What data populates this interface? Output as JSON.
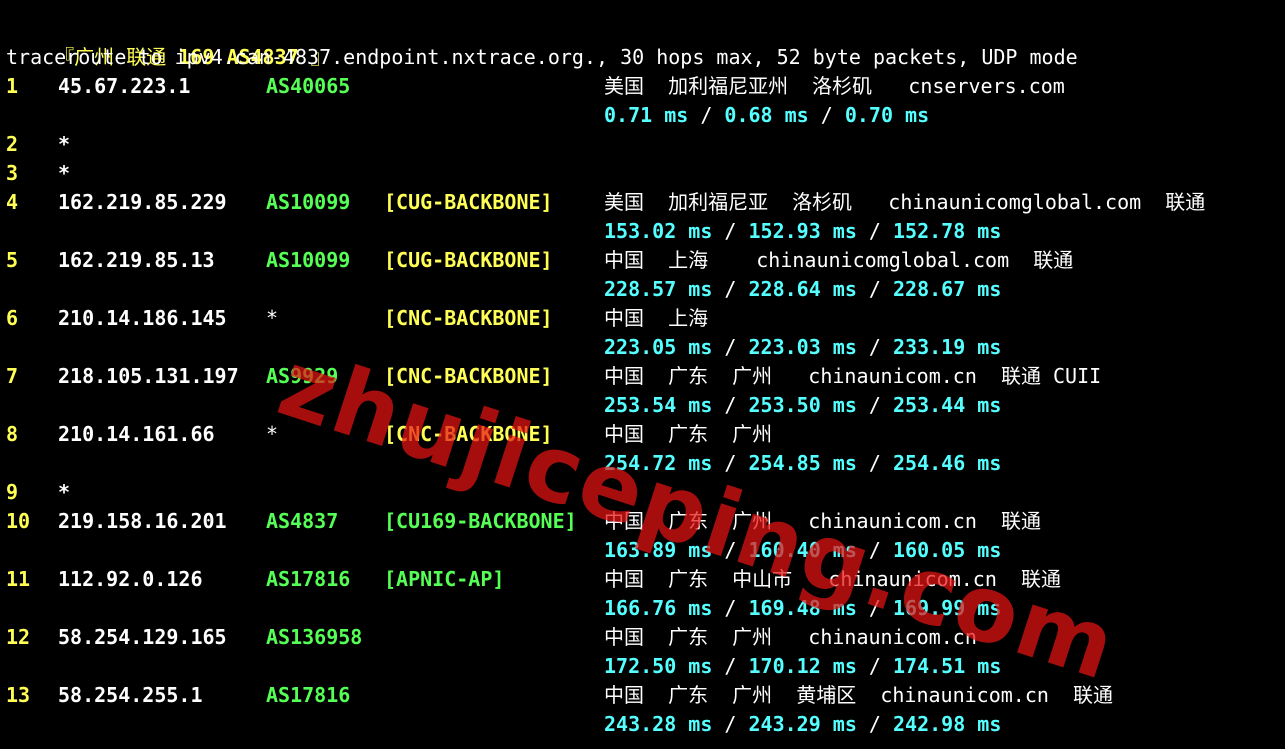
{
  "header": {
    "bracket_open": "『",
    "city": "广州",
    "isp": "联通",
    "route_no": "169",
    "asn": "AS4837",
    "bracket_close": "』"
  },
  "command_line": "traceroute to ipv4.can-4837.endpoint.nxtrace.org., 30 hops max, 52 byte packets, UDP mode",
  "hops": [
    {
      "hop": "1",
      "ip": "45.67.223.1",
      "asn": "AS40065",
      "tag": "",
      "geo": "美国  加利福尼亚州  洛杉矶   cnservers.com",
      "rtt": [
        "0.71 ms",
        "0.68 ms",
        "0.70 ms"
      ]
    },
    {
      "hop": "2",
      "ip": "*"
    },
    {
      "hop": "3",
      "ip": "*"
    },
    {
      "hop": "4",
      "ip": "162.219.85.229",
      "asn": "AS10099",
      "tag": "[CUG-BACKBONE]",
      "geo": "美国  加利福尼亚  洛杉矶   chinaunicomglobal.com  联通",
      "rtt": [
        "153.02 ms",
        "152.93 ms",
        "152.78 ms"
      ]
    },
    {
      "hop": "5",
      "ip": "162.219.85.13",
      "asn": "AS10099",
      "tag": "[CUG-BACKBONE]",
      "geo": "中国  上海    chinaunicomglobal.com  联通",
      "rtt": [
        "228.57 ms",
        "228.64 ms",
        "228.67 ms"
      ]
    },
    {
      "hop": "6",
      "ip": "210.14.186.145",
      "asn": "*",
      "tag": "[CNC-BACKBONE]",
      "geo": "中国  上海",
      "rtt": [
        "223.05 ms",
        "223.03 ms",
        "233.19 ms"
      ]
    },
    {
      "hop": "7",
      "ip": "218.105.131.197",
      "asn": "AS9929",
      "tag": "[CNC-BACKBONE]",
      "geo": "中国  广东  广州   chinaunicom.cn  联通 CUII",
      "rtt": [
        "253.54 ms",
        "253.50 ms",
        "253.44 ms"
      ]
    },
    {
      "hop": "8",
      "ip": "210.14.161.66",
      "asn": "*",
      "tag": "[CNC-BACKBONE]",
      "geo": "中国  广东  广州",
      "rtt": [
        "254.72 ms",
        "254.85 ms",
        "254.46 ms"
      ]
    },
    {
      "hop": "9",
      "ip": "*"
    },
    {
      "hop": "10",
      "ip": "219.158.16.201",
      "asn": "AS4837",
      "tag": "[CU169-BACKBONE]",
      "tag_color": "green",
      "geo": "中国  广东  广州   chinaunicom.cn  联通",
      "rtt": [
        "163.89 ms",
        "160.40 ms",
        "160.05 ms"
      ]
    },
    {
      "hop": "11",
      "ip": "112.92.0.126",
      "asn": "AS17816",
      "tag": "[APNIC-AP]",
      "tag_color": "green",
      "geo": "中国  广东  中山市   chinaunicom.cn  联通",
      "rtt": [
        "166.76 ms",
        "169.48 ms",
        "169.99 ms"
      ]
    },
    {
      "hop": "12",
      "ip": "58.254.129.165",
      "asn": "AS136958",
      "tag": "",
      "geo": "中国  广东  广州   chinaunicom.cn",
      "rtt": [
        "172.50 ms",
        "170.12 ms",
        "174.51 ms"
      ]
    },
    {
      "hop": "13",
      "ip": "58.254.255.1",
      "asn": "AS17816",
      "tag": "",
      "geo": "中国  广东  广州  黄埔区  chinaunicom.cn  联通",
      "rtt": [
        "243.28 ms",
        "243.29 ms",
        "242.98 ms"
      ]
    }
  ],
  "watermark": "zhujiceping.com",
  "colors": {
    "background": "#000000",
    "hop_number": "#ffff55",
    "asn": "#55ff55",
    "rtt": "#55ffff",
    "watermark": "#e61414"
  }
}
